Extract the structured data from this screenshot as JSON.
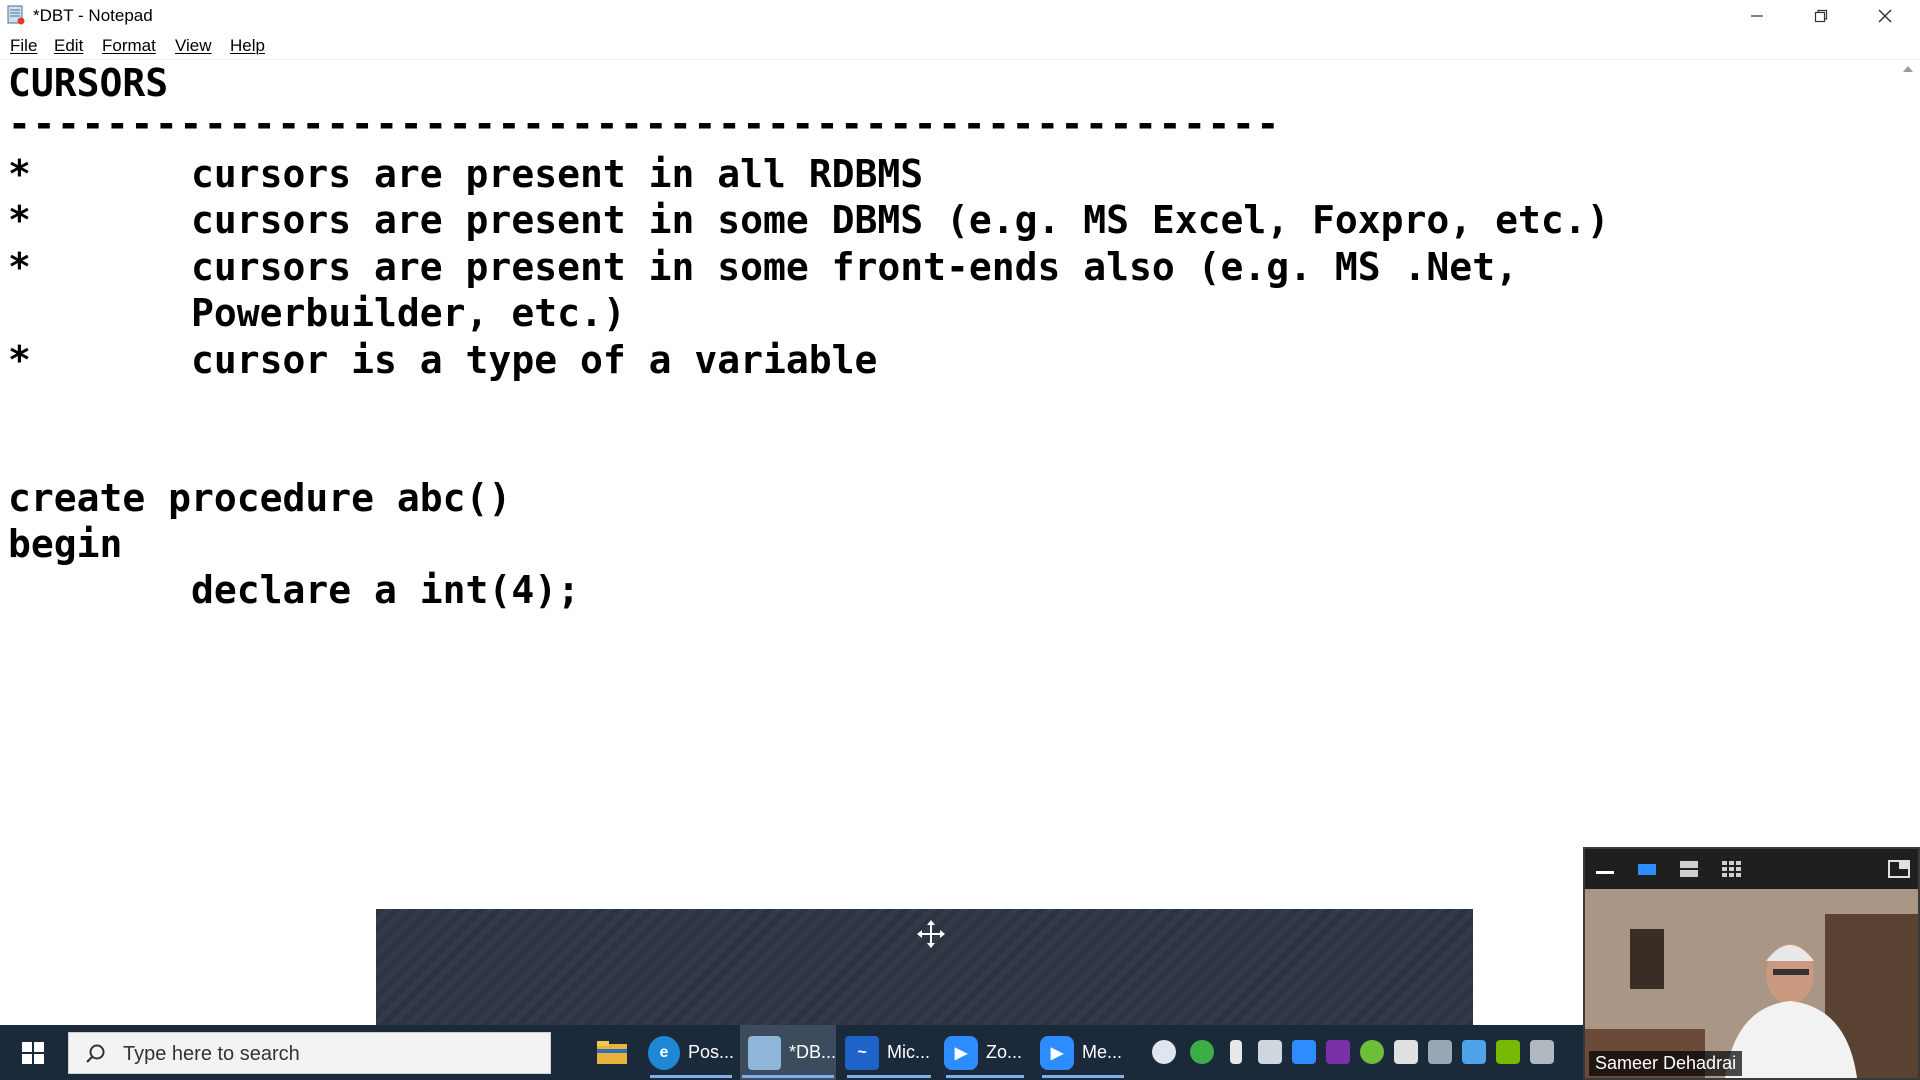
{
  "window": {
    "title": "*DBT - Notepad",
    "controls": {
      "minimize": "minimize",
      "restore": "restore",
      "close": "close"
    }
  },
  "menu": {
    "items": [
      {
        "label": "File"
      },
      {
        "label": "Edit"
      },
      {
        "label": "Format"
      },
      {
        "label": "View"
      },
      {
        "label": "Help"
      }
    ]
  },
  "editor": {
    "lines": [
      "CURSORS",
      "----------------------------------------------------",
      "*       cursors are present in all RDBMS",
      "*       cursors are present in some DBMS (e.g. MS Excel, Foxpro, etc.)",
      "*       cursors are present in some front-ends also (e.g. MS .Net,",
      "        Powerbuilder, etc.)",
      "*       cursor is a type of a variable",
      "",
      "",
      "create procedure abc()",
      "begin",
      "        declare a int(4);"
    ]
  },
  "taskbar": {
    "search_placeholder": "Type here to search",
    "apps": [
      {
        "label": "",
        "icon": "file-explorer-icon",
        "color": "#e8b33a"
      },
      {
        "label": "Pos...",
        "icon": "edge-icon",
        "color": "#1e88d6"
      },
      {
        "label": "*DB...",
        "icon": "notepad-icon",
        "color": "#8fb6d9"
      },
      {
        "label": "Mic...",
        "icon": "whiteboard-icon",
        "color": "#1f63c9"
      },
      {
        "label": "Zo...",
        "icon": "zoom-icon",
        "color": "#2d8cff"
      },
      {
        "label": "Me...",
        "icon": "zoom-meeting-icon",
        "color": "#2d8cff"
      }
    ]
  },
  "video": {
    "participant_name": "Sameer Dehadrai"
  },
  "colors": {
    "taskbar": "#1b2a3a",
    "share_panel": "#2b3440",
    "accent": "#2d8cff"
  }
}
